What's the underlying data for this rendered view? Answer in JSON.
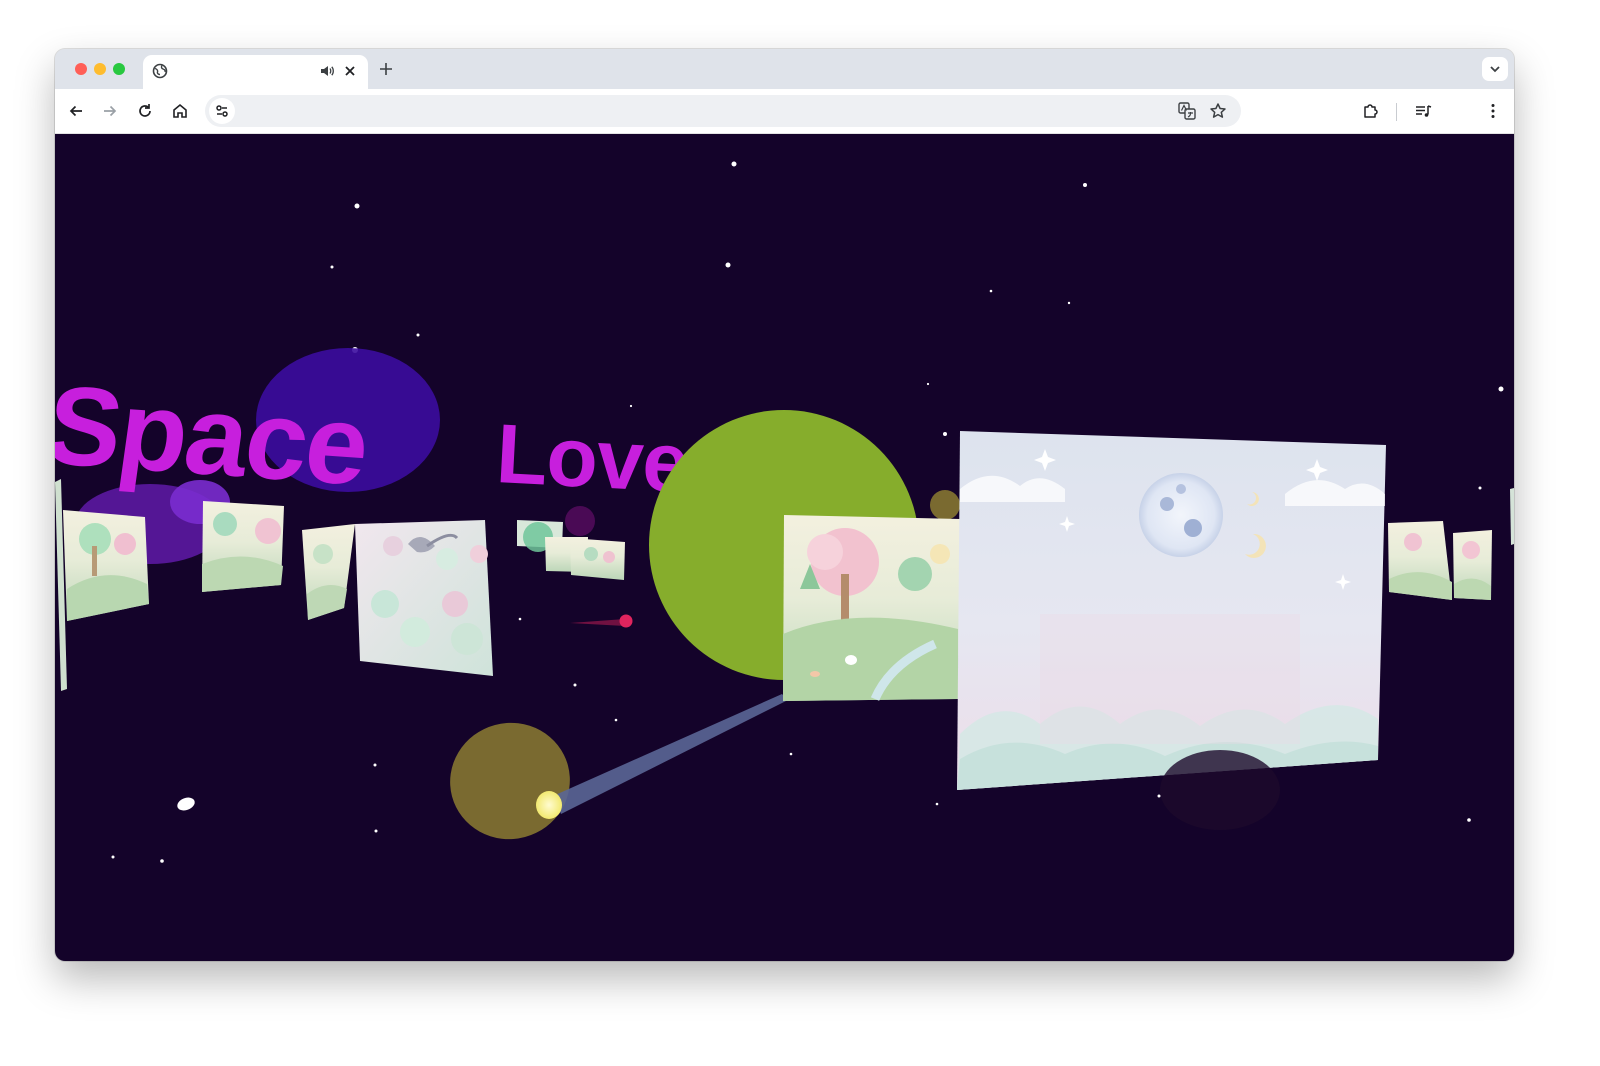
{
  "browser": {
    "tab": {
      "title": "",
      "favicon": "globe-icon",
      "audio_icon": "speaker-icon",
      "close_icon": "close-icon"
    },
    "new_tab_icon": "plus-icon",
    "tab_search_icon": "chevron-down-icon",
    "toolbar": {
      "back_icon": "arrow-left-icon",
      "forward_icon": "arrow-right-icon",
      "reload_icon": "reload-icon",
      "home_icon": "home-icon",
      "site_info_icon": "tune-icon",
      "url": "",
      "translate_icon": "translate-icon",
      "bookmark_icon": "star-icon",
      "extensions_icon": "puzzle-icon",
      "media_icon": "queue-music-icon",
      "menu_icon": "kebab-menu-icon"
    }
  },
  "scene": {
    "title_word_1": "Space",
    "title_word_2": "Love",
    "colors": {
      "background": "#14032a",
      "title": "#c71fdd",
      "planet_green": "#86ad2c",
      "planet_olive": "#7a6a30",
      "blob_indigo": "#3b0c9e",
      "blob_purple": "#7a1dc4",
      "beam": "#5a6696",
      "glow": "#f7f08a",
      "meteor": "#e0245e",
      "card_pastel": "#d8e6dc"
    }
  }
}
